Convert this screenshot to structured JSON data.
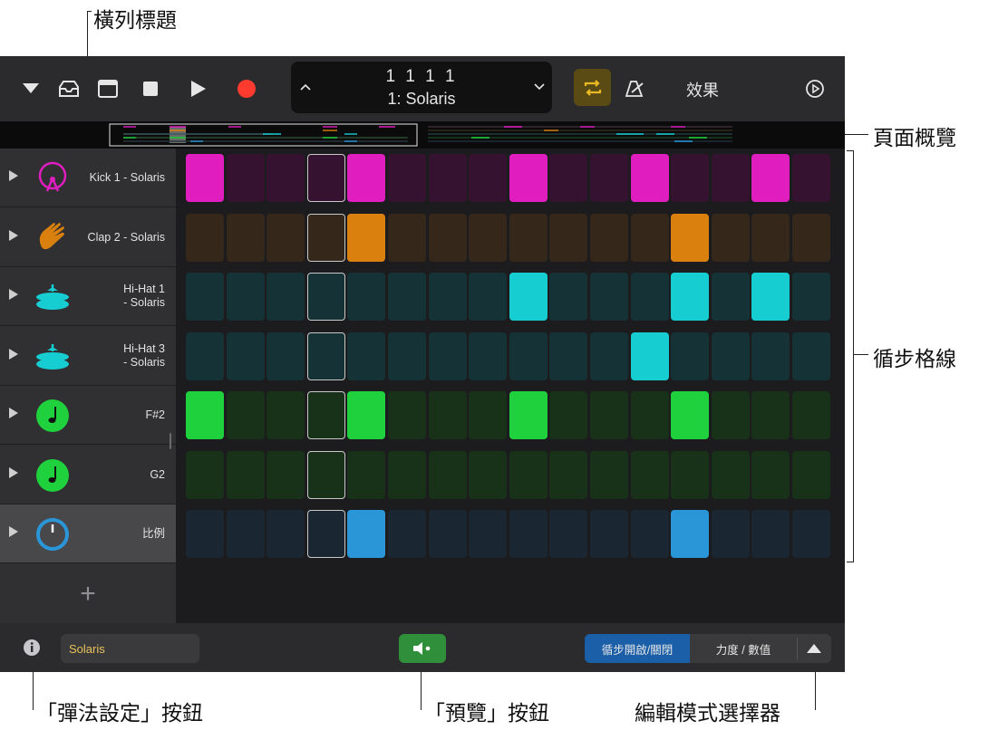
{
  "callouts": {
    "row_header": "橫列標題",
    "page_overview": "頁面概覽",
    "step_grid": "循步格線",
    "play_settings_button": "「彈法設定」按鈕",
    "preview_button": "「預覽」按鈕",
    "edit_mode_selector": "編輯模式選擇器"
  },
  "toolbar": {
    "position": "1 1 1     1",
    "pattern_name": "1: Solaris",
    "effects_label": "效果",
    "cycle_active_color": "#e8b923",
    "record_color": "#ff3b30"
  },
  "rows": [
    {
      "label": "Kick 1 - Solaris",
      "icon": "kick-drum-icon",
      "color": "#e01ec0",
      "dim": "#361231",
      "steps": [
        1,
        0,
        0,
        0,
        1,
        0,
        0,
        0,
        1,
        0,
        0,
        1,
        0,
        0,
        1,
        0
      ]
    },
    {
      "label": "Clap 2 - Solaris",
      "icon": "clap-hand-icon",
      "color": "#d9800f",
      "dim": "#352719",
      "steps": [
        0,
        0,
        0,
        0,
        1,
        0,
        0,
        0,
        0,
        0,
        0,
        0,
        1,
        0,
        0,
        0
      ]
    },
    {
      "label": "Hi-Hat 1\n- Solaris",
      "icon": "hihat-icon",
      "color": "#16cdd1",
      "dim": "#153236",
      "steps": [
        0,
        0,
        0,
        0,
        0,
        0,
        0,
        0,
        1,
        0,
        0,
        0,
        1,
        0,
        1,
        0
      ]
    },
    {
      "label": "Hi-Hat 3\n- Solaris",
      "icon": "hihat-icon",
      "color": "#16cdd1",
      "dim": "#153236",
      "steps": [
        0,
        0,
        0,
        0,
        0,
        0,
        0,
        0,
        0,
        0,
        0,
        1,
        0,
        0,
        0,
        0
      ]
    },
    {
      "label": "F#2",
      "icon": "note-icon",
      "color": "#1ed13d",
      "dim": "#183219",
      "steps": [
        1,
        0,
        0,
        0,
        1,
        0,
        0,
        0,
        1,
        0,
        0,
        0,
        1,
        0,
        0,
        0
      ]
    },
    {
      "label": "G2",
      "icon": "note-icon",
      "color": "#1ed13d",
      "dim": "#183219",
      "steps": [
        0,
        0,
        0,
        0,
        0,
        0,
        0,
        0,
        0,
        0,
        0,
        0,
        0,
        0,
        0,
        0
      ]
    },
    {
      "label": "比例",
      "icon": "scale-knob-icon",
      "color": "#2a96d8",
      "dim": "#1a2733",
      "steps": [
        0,
        0,
        0,
        0,
        1,
        0,
        0,
        0,
        0,
        0,
        0,
        0,
        1,
        0,
        0,
        0
      ]
    }
  ],
  "playhead_step": 3,
  "add_row_label": "+",
  "bottom": {
    "pattern_name": "Solaris",
    "mode_step_on_off": "循步開啟/關閉",
    "mode_velocity": "力度 / 數值",
    "active_mode_color": "#1b5fa8"
  }
}
